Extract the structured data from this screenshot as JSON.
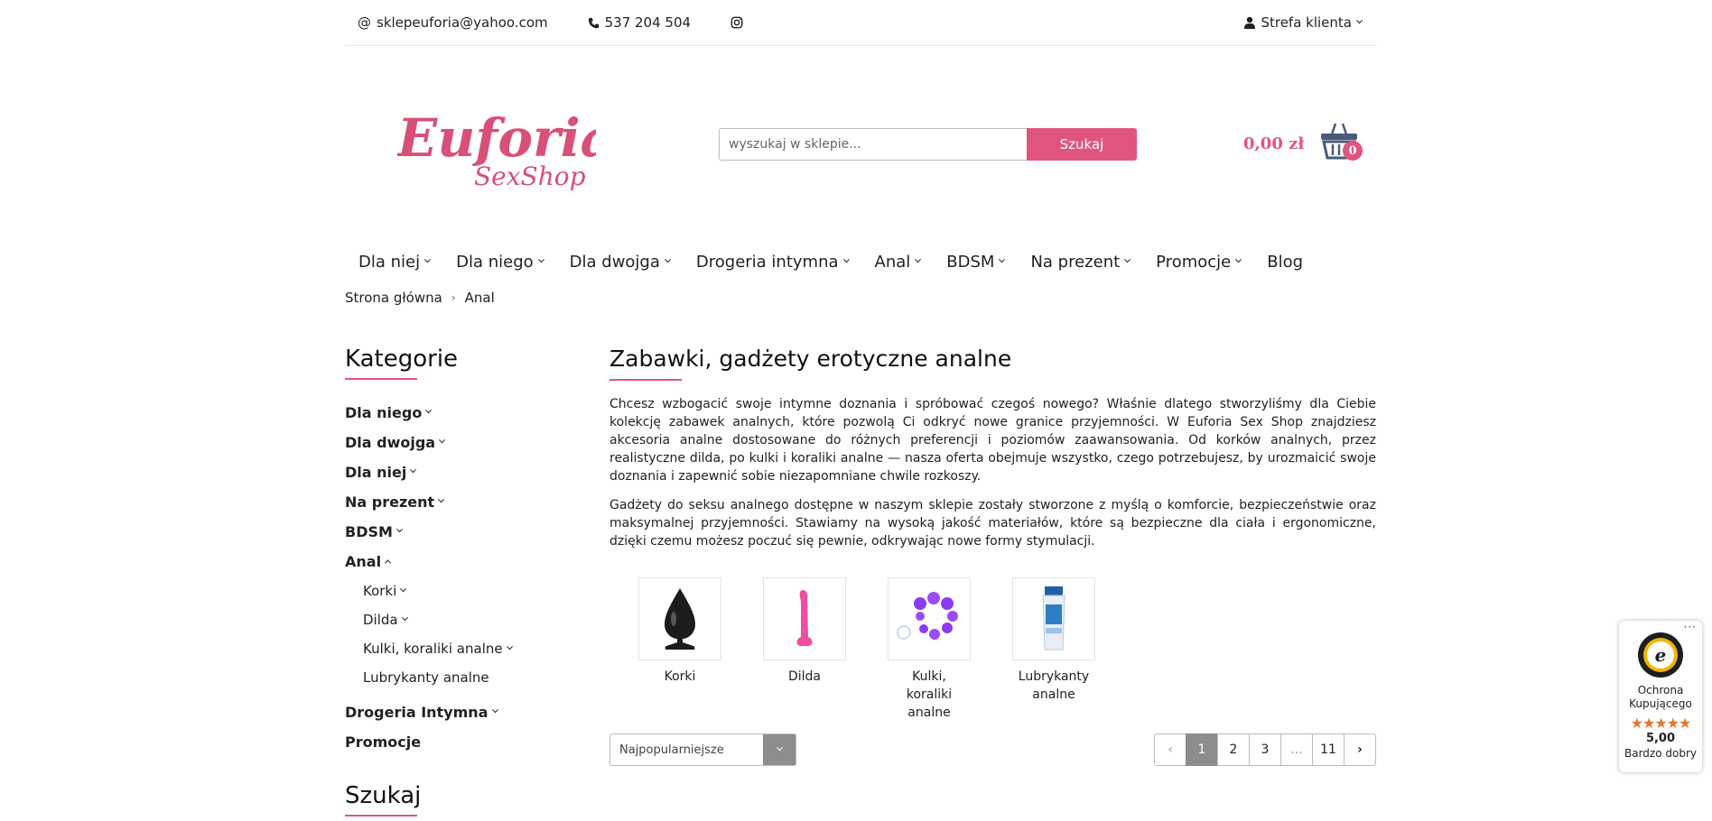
{
  "topbar": {
    "email": "sklepeuforia@yahoo.com",
    "phone": "537 204 504",
    "client_zone": "Strefa klienta"
  },
  "header": {
    "logo_main": "Euforia",
    "logo_sub": "SexShop",
    "search_placeholder": "wyszukaj w sklepie...",
    "search_button": "Szukaj",
    "cart_total": "0,00 zł",
    "cart_count": "0"
  },
  "nav": {
    "items": [
      "Dla niej",
      "Dla niego",
      "Dla dwojga",
      "Drogeria intymna",
      "Anal",
      "BDSM",
      "Na prezent",
      "Promocje",
      "Blog"
    ]
  },
  "breadcrumb": {
    "home": "Strona główna",
    "current": "Anal"
  },
  "sidebar": {
    "title": "Kategorie",
    "categories": [
      "Dla niego",
      "Dla dwojga",
      "Dla niej",
      "Na prezent",
      "BDSM",
      "Anal"
    ],
    "subcategories": [
      "Korki",
      "Dilda",
      "Kulki, koraliki analne",
      "Lubrykanty analne"
    ],
    "categories_after": [
      "Drogeria Intymna",
      "Promocje"
    ],
    "search_title": "Szukaj"
  },
  "main": {
    "title": "Zabawki, gadżety erotyczne analne",
    "paragraph_1": "Chcesz wzbogacić swoje intymne doznania i spróbować czegoś nowego? Właśnie dlatego stworzyliśmy dla Ciebie kolekcję zabawek analnych, które pozwolą Ci odkryć nowe granice przyjemności. W Euforia Sex Shop znajdziesz akcesoria analne dostosowane do różnych preferencji i poziomów zaawansowania. Od korków analnych, przez realistyczne dilda, po kulki i koraliki analne — nasza oferta obejmuje wszystko, czego potrzebujesz, by urozmaicić swoje doznania i zapewnić sobie niezapomniane chwile rozkoszy.",
    "paragraph_2": "Gadżety do seksu analnego dostępne w naszym sklepie zostały stworzone z myślą o komforcie, bezpieczeństwie oraz maksymalnej przyjemności. Stawiamy na wysoką jakość materiałów, które są bezpieczne dla ciała i ergonomiczne, dzięki czemu możesz poczuć się pewnie, odkrywając nowe formy stymulacji.",
    "tiles": [
      "Korki",
      "Dilda",
      "Kulki, koraliki analne",
      "Lubrykanty analne"
    ],
    "sort_value": "Najpopularniejsze",
    "pages": [
      "1",
      "2",
      "3",
      "...",
      "11"
    ]
  },
  "trust": {
    "label": "Ochrona Kupującego",
    "stars": "★★★★★",
    "score": "5,00",
    "rating": "Bardzo dobry"
  },
  "colors": {
    "accent": "#e0557f",
    "pager_active": "#8d8d8d",
    "star": "#e6762e"
  }
}
